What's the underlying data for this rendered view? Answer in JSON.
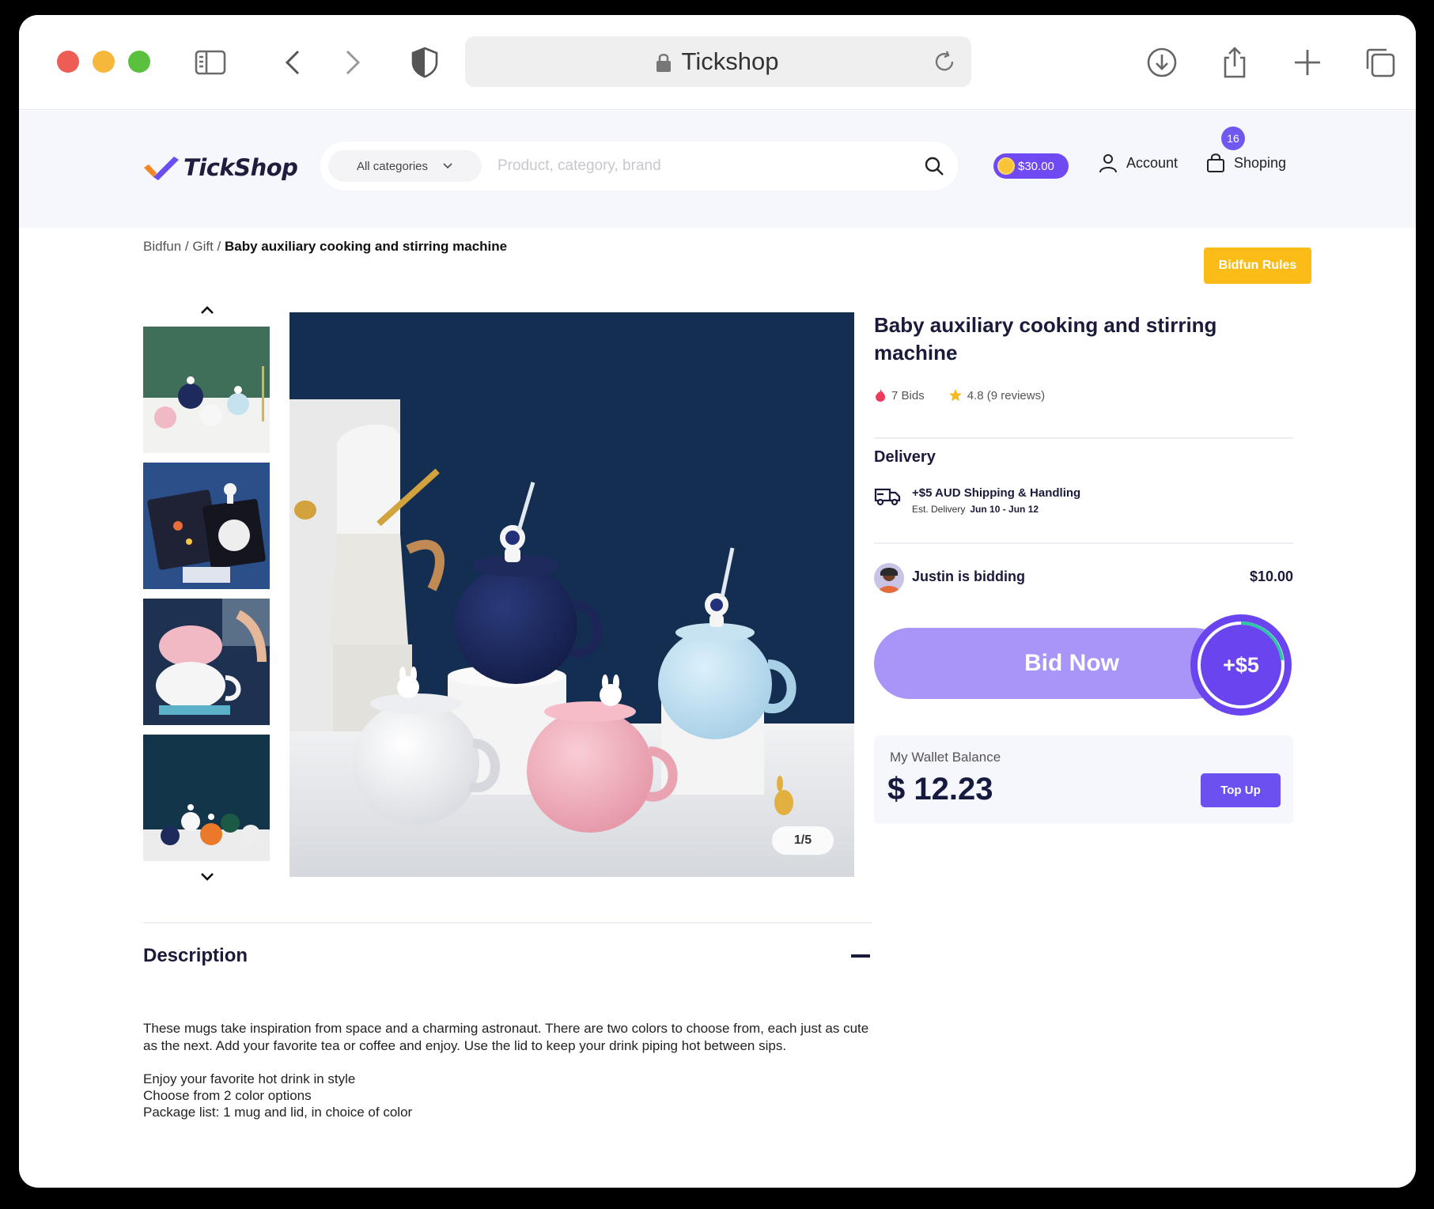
{
  "browser": {
    "address": "Tickshop"
  },
  "header": {
    "logo_text": "TickShop",
    "category_select": "All categories",
    "search_placeholder": "Product, category, brand",
    "balance_pill": "$30.00",
    "account_label": "Account",
    "shop_label": "Shoping",
    "cart_count": "16"
  },
  "breadcrumb": {
    "part1": "Bidfun",
    "sep1": " / ",
    "part2": "Gift",
    "sep2": " / ",
    "current": "Baby auxiliary cooking and stirring machine"
  },
  "rules_button": "Bidfun Rules",
  "gallery": {
    "counter": "1/5",
    "thumbnails": [
      "mugs-green",
      "astronaut-box",
      "pink-mug",
      "mugs-navy"
    ]
  },
  "product": {
    "title": "Baby auxiliary cooking and stirring machine",
    "bids": "7 Bids",
    "rating": "4.8 (9 reviews)"
  },
  "delivery": {
    "title": "Delivery",
    "shipping": "+$5 AUD Shipping & Handling",
    "est_label": "Est. Delivery",
    "est_dates": "Jun 10 - Jun 12"
  },
  "bidding": {
    "bidder_text": "Justin is bidding",
    "amount": "$10.00",
    "bid_now": "Bid Now",
    "increment": "+$5"
  },
  "wallet": {
    "label": "My Wallet Balance",
    "amount": "$ 12.23",
    "topup": "Top Up"
  },
  "description": {
    "title": "Description",
    "paragraph": "These mugs take inspiration from space and a charming astronaut. There are two colors to choose from, each just as cute as the next. Add your favorite tea or coffee and enjoy. Use the lid to keep your drink piping hot between sips.",
    "bullets": [
      "Enjoy your favorite hot drink in style",
      "Choose from 2 color options",
      "Package list: 1 mug and lid, in choice of color"
    ]
  },
  "colors": {
    "accent": "#6c50f0",
    "bid_bar": "#a994f8",
    "rules": "#fcbc18",
    "header_bg": "#f6f6fd"
  }
}
